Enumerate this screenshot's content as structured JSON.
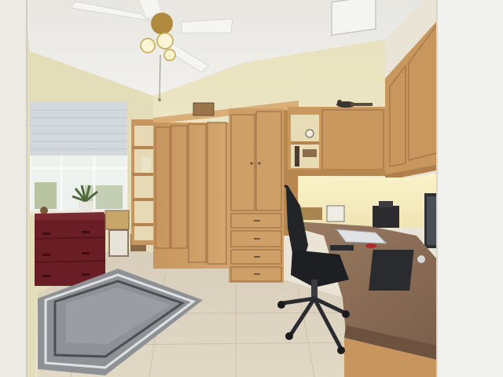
{
  "scene": {
    "kind": "photograph",
    "subject": "home-office",
    "palette": {
      "ceiling": "#ecebe6",
      "wall_left": "#e6e0bd",
      "wall_back": "#ece6c4",
      "cabinet_wood": "#c99a64",
      "cabinet_wood_dark": "#a9784a",
      "cabinet_wood_light": "#d9ae78",
      "floor_tile": "#d6ccbb",
      "floor_grout": "#c4b9a6",
      "dresser_red": "#6a1d24",
      "rug_gray": "#8e9296",
      "rug_border": "#4a4f55",
      "countertop": "#8a6c55",
      "chair_black": "#232427",
      "window_light": "#f4f6f8",
      "blind": "#cfd4da",
      "right_wall": "#f2f2f0",
      "ceiling_fan_blade": "#f5f5f2",
      "fan_brass": "#b08a3e"
    },
    "objects": [
      "ceiling-fan",
      "window-with-blind",
      "red-dresser",
      "potted-plant",
      "wall-cabinets",
      "tall-wardrobe-cabinets",
      "open-shelves",
      "desk-countertop",
      "office-chair",
      "area-rug",
      "laptop",
      "printer",
      "monitor",
      "decorative-bird",
      "basket",
      "air-vent"
    ]
  }
}
